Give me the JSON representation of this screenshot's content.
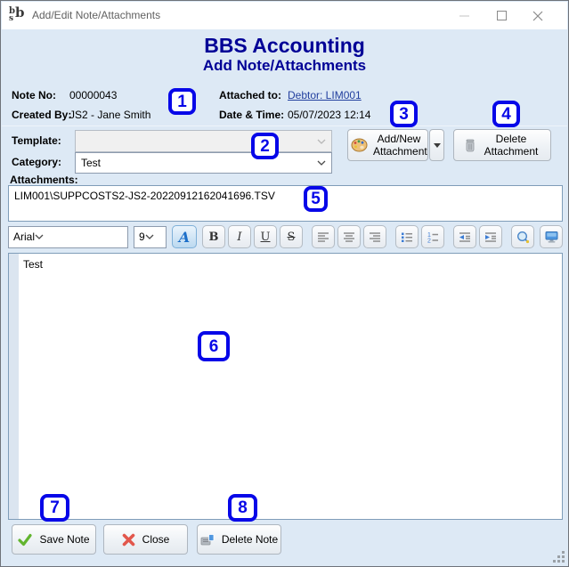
{
  "window": {
    "title": "Add/Edit Note/Attachments",
    "app_icon": "bsb-logo",
    "controls": [
      "minimize",
      "maximize",
      "close"
    ]
  },
  "header": {
    "title": "BBS Accounting",
    "subtitle": "Add Note/Attachments"
  },
  "info": {
    "note_no_label": "Note No:",
    "note_no": "00000043",
    "attached_to_label": "Attached to:",
    "attached_to_link": "Debtor: LIM001",
    "created_by_label": "Created By:",
    "created_by": "JS2 - Jane Smith",
    "datetime_label": "Date & Time:",
    "datetime": "05/07/2023 12:14"
  },
  "form": {
    "template_label": "Template:",
    "template_value": "",
    "category_label": "Category:",
    "category_value": "Test",
    "attachments_label": "Attachments:",
    "attachment_items": [
      "LIM001\\SUPPCOSTS2-JS2-20220912162041696.TSV"
    ]
  },
  "attachment_actions": {
    "add_new_label": "Add/New Attachment",
    "delete_label": "Delete Attachment",
    "icons": [
      "palette-icon",
      "dropdown-arrow-icon",
      "trash-icon"
    ]
  },
  "editor": {
    "font_value": "Arial",
    "size_value": "9",
    "toolbar": {
      "color_glyph": "A",
      "bold": "B",
      "italic": "I",
      "underline": "U",
      "strikethrough": "S",
      "icon_names": [
        "font-color-icon",
        "align-left-icon",
        "align-center-icon",
        "align-right-icon",
        "bullet-list-icon",
        "numbered-list-icon",
        "outdent-icon",
        "indent-icon",
        "zoom-icon",
        "monitor-icon"
      ]
    },
    "content": "Test"
  },
  "footer": {
    "save_label": "Save Note",
    "close_label": "Close",
    "delete_label": "Delete Note"
  },
  "annotations": [
    "1",
    "2",
    "3",
    "4",
    "5",
    "6",
    "7",
    "8"
  ],
  "colors": {
    "header_navy": "#000096",
    "annotation_blue": "#0707e8",
    "link_blue": "#23409f",
    "box_border": "#7f9db9",
    "body_bg": "#dde9f5"
  }
}
